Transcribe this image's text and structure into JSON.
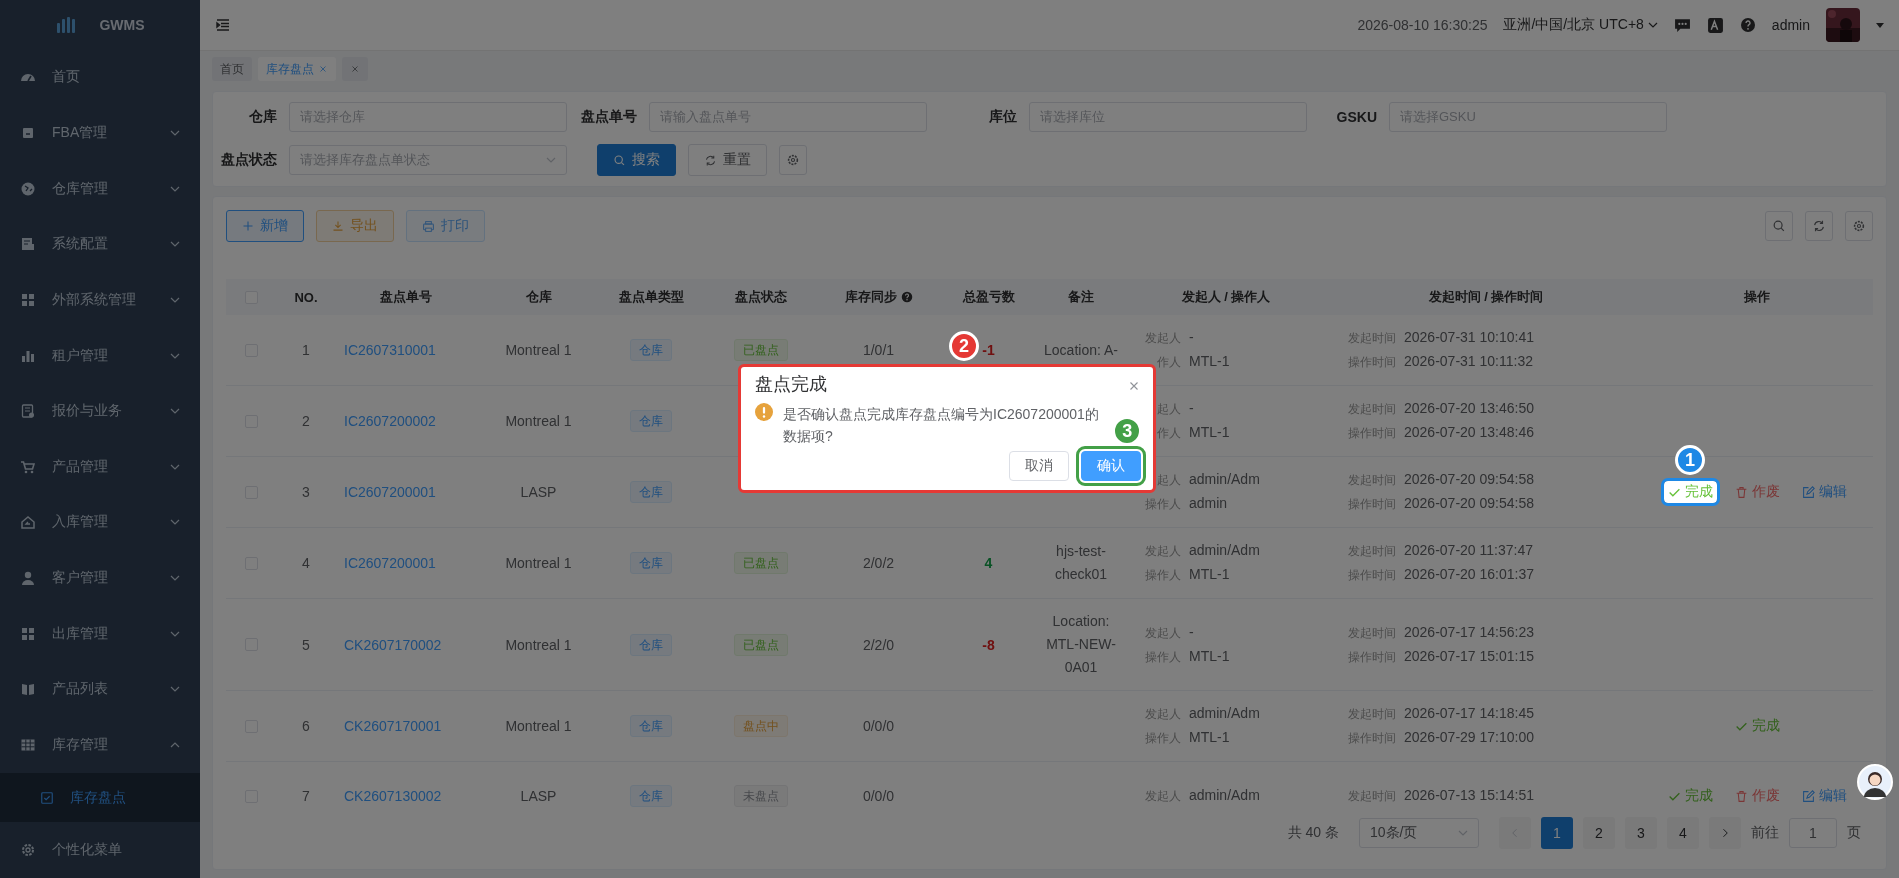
{
  "sidebar": {
    "logo": "GWMS",
    "items": [
      {
        "label": "首页",
        "kind": "link"
      },
      {
        "label": "FBA管理",
        "kind": "group",
        "expanded": false
      },
      {
        "label": "仓库管理",
        "kind": "group",
        "expanded": false
      },
      {
        "label": "系统配置",
        "kind": "group",
        "expanded": false
      },
      {
        "label": "外部系统管理",
        "kind": "group",
        "expanded": false
      },
      {
        "label": "租户管理",
        "kind": "group",
        "expanded": false
      },
      {
        "label": "报价与业务",
        "kind": "group",
        "expanded": false
      },
      {
        "label": "产品管理",
        "kind": "group",
        "expanded": false
      },
      {
        "label": "入库管理",
        "kind": "group",
        "expanded": false
      },
      {
        "label": "客户管理",
        "kind": "group",
        "expanded": false
      },
      {
        "label": "出库管理",
        "kind": "group",
        "expanded": false
      },
      {
        "label": "产品列表",
        "kind": "group",
        "expanded": false
      },
      {
        "label": "库存管理",
        "kind": "group",
        "expanded": true,
        "children": [
          {
            "label": "库存盘点",
            "selected": true
          }
        ]
      },
      {
        "label": "个性化菜单",
        "kind": "link"
      }
    ]
  },
  "header": {
    "datetime": "2026-08-10 16:30:25",
    "timezone": "亚洲/中国/北京 UTC+8",
    "user": "admin"
  },
  "tabs": [
    {
      "label": "首页",
      "selected": false,
      "closable": false
    },
    {
      "label": "库存盘点",
      "selected": true,
      "closable": true
    }
  ],
  "filters": [
    {
      "label": "仓库",
      "placeholder": "请选择仓库",
      "kind": "input"
    },
    {
      "label": "盘点单号",
      "placeholder": "请输入盘点单号",
      "kind": "input"
    },
    {
      "label": "库位",
      "placeholder": "请选择库位",
      "kind": "input"
    },
    {
      "label": "GSKU",
      "placeholder": "请选择GSKU",
      "kind": "input"
    },
    {
      "label": "盘点状态",
      "placeholder": "请选择库存盘点单状态",
      "kind": "select"
    }
  ],
  "filter_buttons": [
    {
      "label": "搜索",
      "kind": "search"
    },
    {
      "label": "重置",
      "kind": "reset"
    },
    {
      "kind": "settings"
    }
  ],
  "toolbar": [
    {
      "label": "新增",
      "kind": "add",
      "disabled": false
    },
    {
      "label": "导出",
      "kind": "export",
      "disabled": false
    },
    {
      "label": "打印",
      "kind": "print",
      "disabled": true
    }
  ],
  "table": {
    "select_all_checked": false,
    "columns": [
      {
        "label": "NO."
      },
      {
        "label": "盘点单号"
      },
      {
        "label": "仓库"
      },
      {
        "label": "盘点单类型"
      },
      {
        "label": "盘点状态"
      },
      {
        "label": "库存同步",
        "help": true
      },
      {
        "label": "总盈亏数"
      },
      {
        "label": "备注"
      },
      {
        "label": "发起人 / 操作人"
      },
      {
        "label": "发起时间 / 操作时间"
      },
      {
        "label": "操作"
      }
    ],
    "rows": [
      {
        "checked": false,
        "no": "1",
        "code": "IC2607310001",
        "warehouse": "Montreal 1",
        "type": "仓库",
        "status": {
          "label": "已盘点",
          "kind": "done"
        },
        "sync": "1/0/1",
        "total": {
          "value": "-1",
          "negative": true
        },
        "note": [
          "Location: A-"
        ],
        "initiator_label": "发起人",
        "initiator": "-",
        "operator_label": "作人",
        "operator": "MTL-1",
        "start_label": "发起时间",
        "start": "2026-07-31 10:10:41",
        "op_label": "操作时间",
        "op_time": "2026-07-31 10:11:32",
        "actions": []
      },
      {
        "checked": false,
        "no": "2",
        "code": "IC2607200002",
        "warehouse": "Montreal 1",
        "type": "仓库",
        "initiator_label": "起人",
        "initiator": "-",
        "operator_label": "作人",
        "operator": "MTL-1",
        "start_label": "发起时间",
        "start": "2026-07-20 13:46:50",
        "op_label": "操作时间",
        "op_time": "2026-07-20 13:48:46",
        "actions": []
      },
      {
        "checked": false,
        "no": "3",
        "code": "IC2607200001",
        "warehouse": "LASP",
        "type": "仓库",
        "initiator_label": "起人",
        "initiator": "admin/Adm",
        "operator_label": "操作人",
        "operator": "admin",
        "start_label": "发起时间",
        "start": "2026-07-20 09:54:58",
        "op_label": "操作时间",
        "op_time": "2026-07-20 09:54:58",
        "actions": [
          {
            "kind": "complete",
            "label": "完成",
            "marker": {
              "label": "1",
              "color": "#1e88e5"
            }
          },
          {
            "kind": "void",
            "label": "作废"
          },
          {
            "kind": "edit",
            "label": "编辑"
          }
        ]
      },
      {
        "checked": false,
        "no": "4",
        "code": "IC2607200001",
        "warehouse": "Montreal 1",
        "type": "仓库",
        "status": {
          "label": "已盘点",
          "kind": "done"
        },
        "sync": "2/0/2",
        "total": {
          "value": "4",
          "negative": false
        },
        "note": [
          "hjs-test-",
          "check01"
        ],
        "initiator_label": "发起人",
        "initiator": "admin/Adm",
        "operator_label": "操作人",
        "operator": "MTL-1",
        "start_label": "发起时间",
        "start": "2026-07-20 11:37:47",
        "op_label": "操作时间",
        "op_time": "2026-07-20 16:01:37",
        "actions": []
      },
      {
        "checked": false,
        "no": "5",
        "code": "CK2607170002",
        "warehouse": "Montreal 1",
        "type": "仓库",
        "status": {
          "label": "已盘点",
          "kind": "done"
        },
        "sync": "2/2/0",
        "total": {
          "value": "-8",
          "negative": true
        },
        "note": [
          "Location:",
          "MTL-NEW-",
          "0A01"
        ],
        "initiator_label": "发起人",
        "initiator": "-",
        "operator_label": "操作人",
        "operator": "MTL-1",
        "start_label": "发起时间",
        "start": "2026-07-17 14:56:23",
        "op_label": "操作时间",
        "op_time": "2026-07-17 15:01:15",
        "actions": []
      },
      {
        "checked": false,
        "no": "6",
        "code": "CK2607170001",
        "warehouse": "Montreal 1",
        "type": "仓库",
        "status": {
          "label": "盘点中",
          "kind": "in_progress"
        },
        "sync": "0/0/0",
        "initiator_label": "发起人",
        "initiator": "admin/Adm",
        "operator_label": "操作人",
        "operator": "MTL-1",
        "start_label": "发起时间",
        "start": "2026-07-17 14:18:45",
        "op_label": "操作时间",
        "op_time": "2026-07-29 17:10:00",
        "actions": [
          {
            "kind": "complete",
            "label": "完成"
          }
        ]
      },
      {
        "checked": false,
        "no": "7",
        "code": "CK2607130002",
        "warehouse": "LASP",
        "type": "仓库",
        "status": {
          "label": "未盘点",
          "kind": "pending"
        },
        "sync": "0/0/0",
        "initiator_label": "发起人",
        "initiator": "admin/Adm",
        "start_label": "发起时间",
        "start": "2026-07-13 15:14:51",
        "actions": [
          {
            "kind": "complete",
            "label": "完成"
          },
          {
            "kind": "void",
            "label": "作废"
          },
          {
            "kind": "edit",
            "label": "编辑"
          }
        ]
      }
    ]
  },
  "pagination": {
    "total": "共 40 条",
    "page_size": "10条/页",
    "prev_disabled": true,
    "next_disabled": false,
    "pages": [
      {
        "label": "1",
        "selected": true
      },
      {
        "label": "2",
        "selected": false
      },
      {
        "label": "3",
        "selected": false
      },
      {
        "label": "4",
        "selected": false
      }
    ],
    "goto_label": "前往",
    "goto_value": "1",
    "page_suffix": "页"
  },
  "dialog": {
    "title": "盘点完成",
    "message": "是否确认盘点完成库存盘点编号为IC2607200001的数据项?",
    "marker": {
      "label": "2",
      "color": "#e53935"
    },
    "buttons": [
      {
        "label": "取消",
        "kind": "default"
      },
      {
        "label": "确认",
        "kind": "primary",
        "marker": {
          "label": "3",
          "color": "#43a047"
        }
      }
    ]
  }
}
